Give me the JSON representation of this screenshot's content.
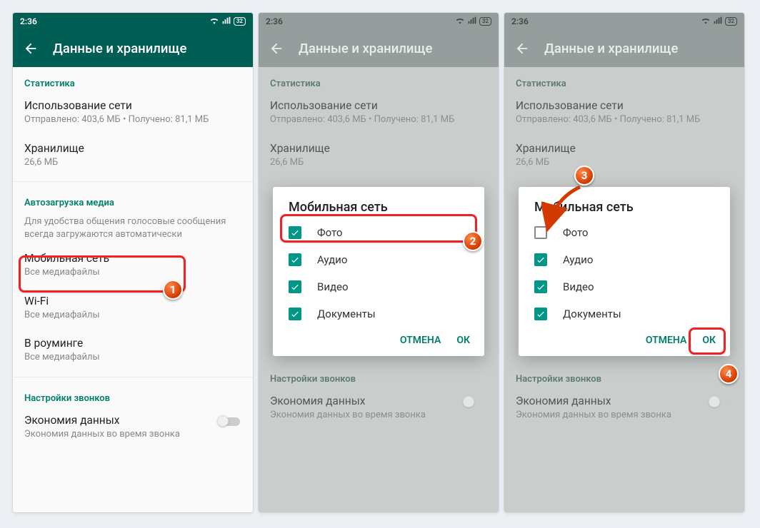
{
  "status": {
    "time": "2:36",
    "battery": "32"
  },
  "appbar": {
    "title": "Данные и хранилище"
  },
  "sections": {
    "stats": "Статистика",
    "autodl": "Автозагрузка медиа",
    "calls": "Настройки звонков"
  },
  "items": {
    "net_title": "Использование сети",
    "net_sub": "Отправлено: 403,6 МБ • Получено: 81,1 МБ",
    "storage_title": "Хранилище",
    "storage_sub": "26,6 МБ",
    "autodl_desc": "Для удобства общения голосовые сообщения всегда загружаются автоматически",
    "mobile_title": "Мобильная сеть",
    "mobile_sub": "Все медиафайлы",
    "wifi_title": "Wi-Fi",
    "wifi_sub": "Все медиафайлы",
    "roaming_title": "В роуминге",
    "roaming_sub": "Все медиафайлы",
    "saver_title": "Экономия данных",
    "saver_sub": "Экономия данных во время звонка"
  },
  "dialog": {
    "title": "Мобильная сеть",
    "opts": {
      "photo": "Фото",
      "audio": "Аудио",
      "video": "Видео",
      "docs": "Документы"
    },
    "cancel": "ОТМЕНА",
    "ok": "ОК"
  },
  "markers": {
    "m1": "1",
    "m2": "2",
    "m3": "3",
    "m4": "4"
  }
}
